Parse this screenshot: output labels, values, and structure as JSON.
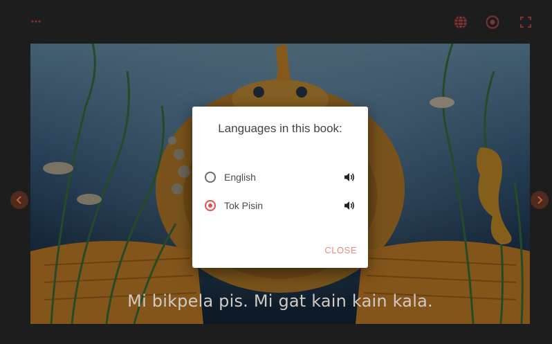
{
  "toolbar": {
    "menu_icon": "more-horizontal-icon",
    "languages_icon": "globe-icon",
    "audio_icon": "play-circle-icon",
    "fullscreen_icon": "fullscreen-icon"
  },
  "page": {
    "caption": "Mi bikpela pis. Mi gat kain kain kala."
  },
  "dialog": {
    "title": "Languages in this book:",
    "languages": [
      {
        "label": "English",
        "selected": false
      },
      {
        "label": "Tok Pisin",
        "selected": true
      }
    ],
    "close_label": "CLOSE"
  },
  "colors": {
    "accent": "#e0504c",
    "toolbar_icon": "#b4433b",
    "background": "#1d1d1d",
    "dialog_bg": "#ffffff"
  }
}
